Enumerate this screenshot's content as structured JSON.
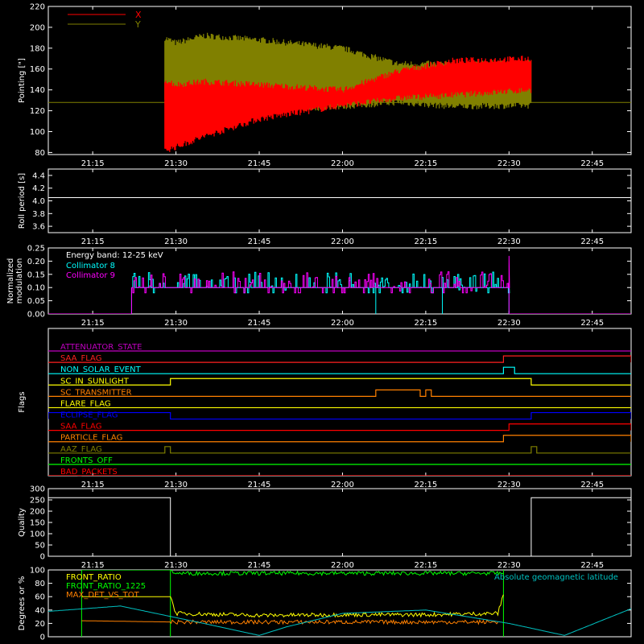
{
  "x_tick_labels": [
    "21:15",
    "21:30",
    "21:45",
    "22:00",
    "22:15",
    "22:30",
    "22:45"
  ],
  "chart_data": [
    {
      "id": "pointing",
      "type": "line",
      "ylabel": "Pointing [\"]",
      "xlabel": "",
      "xlim": [
        "21:07",
        "22:52"
      ],
      "ylim": [
        78,
        220
      ],
      "yticks": [
        80,
        100,
        120,
        140,
        160,
        180,
        200,
        220
      ],
      "x": [
        "21:28",
        "21:30",
        "21:35",
        "21:45",
        "22:00",
        "22:10",
        "22:20",
        "22:34"
      ],
      "series": [
        {
          "name": "X",
          "color": "#ff0000",
          "upper": [
            150,
            145,
            148,
            145,
            140,
            158,
            168,
            170
          ],
          "lower": [
            82,
            85,
            95,
            112,
            125,
            132,
            135,
            140
          ]
        },
        {
          "name": "Y",
          "color": "#808000",
          "upper": [
            190,
            185,
            192,
            188,
            180,
            165,
            165,
            166
          ],
          "lower": [
            128,
            118,
            116,
            120,
            124,
            128,
            124,
            125
          ]
        }
      ],
      "hline": 128,
      "legend_position": "top-left"
    },
    {
      "id": "roll_period",
      "type": "line",
      "ylabel": "Roll period [s]",
      "xlabel": "",
      "xlim": [
        "21:07",
        "22:52"
      ],
      "ylim": [
        3.5,
        4.5
      ],
      "yticks": [
        3.6,
        3.8,
        4.0,
        4.2,
        4.4
      ],
      "x": [
        "21:07",
        "22:52"
      ],
      "values": [
        4.05,
        4.05
      ]
    },
    {
      "id": "modulation",
      "type": "line",
      "ylabel": "Normalized modulation",
      "xlabel": "",
      "xlim": [
        "21:07",
        "22:52"
      ],
      "ylim": [
        0,
        0.25
      ],
      "yticks": [
        0.0,
        0.05,
        0.1,
        0.15,
        0.2,
        0.25
      ],
      "annotation": "Energy band: 12-25 keV",
      "series": [
        {
          "name": "Collimator 8",
          "color": "#00ffff",
          "baseline": 0.1,
          "start": "21:22",
          "end": "22:30"
        },
        {
          "name": "Collimator 9",
          "color": "#ff00ff",
          "baseline": 0.1,
          "start": "21:22",
          "end": "22:30"
        }
      ]
    },
    {
      "id": "flags",
      "type": "line",
      "ylabel": "Flags",
      "xlabel": "",
      "xlim": [
        "21:07",
        "22:52"
      ],
      "series": [
        {
          "name": "ATTENUATOR_STATE",
          "color": "#c000c0",
          "high": []
        },
        {
          "name": "SAA_FLAG",
          "color": "#ff2020",
          "high": [
            [
              "22:29",
              "22:52"
            ]
          ]
        },
        {
          "name": "NON_SOLAR_EVENT",
          "color": "#00ffff",
          "high": [
            [
              "22:29",
              "22:31"
            ]
          ]
        },
        {
          "name": "SC_IN_SUNLIGHT",
          "color": "#ffff00",
          "high": [
            [
              "21:29",
              "22:34"
            ]
          ]
        },
        {
          "name": "SC_TRANSMITTER",
          "color": "#ff8000",
          "high": [
            [
              "22:06",
              "22:14"
            ],
            [
              "22:15",
              "22:16"
            ]
          ]
        },
        {
          "name": "FLARE_FLAG",
          "color": "#ffff00",
          "high": []
        },
        {
          "name": "ECLIPSE_FLAG",
          "color": "#0000ff",
          "high": [
            [
              "21:07",
              "21:29"
            ],
            [
              "22:34",
              "22:52"
            ]
          ]
        },
        {
          "name": "SAA_FLAG",
          "color": "#ff0000",
          "high": [
            [
              "22:30",
              "22:52"
            ]
          ]
        },
        {
          "name": "PARTICLE_FLAG",
          "color": "#ff8000",
          "high": [
            [
              "22:29",
              "22:52"
            ]
          ]
        },
        {
          "name": "AAZ_FLAG",
          "color": "#808000",
          "high": [
            [
              "21:28",
              "21:29"
            ],
            [
              "22:34",
              "22:35"
            ]
          ]
        },
        {
          "name": "FRONTS_OFF",
          "color": "#00ff00",
          "high": []
        },
        {
          "name": "BAD_PACKETS",
          "color": "#ff0000",
          "high": []
        }
      ]
    },
    {
      "id": "quality",
      "type": "line",
      "ylabel": "Quality",
      "xlabel": "",
      "xlim": [
        "21:07",
        "22:52"
      ],
      "ylim": [
        0,
        300
      ],
      "yticks": [
        0,
        50,
        100,
        150,
        200,
        250,
        300
      ],
      "x": [
        "21:07",
        "21:29",
        "21:29",
        "22:34",
        "22:34",
        "22:52"
      ],
      "values": [
        260,
        260,
        0,
        0,
        260,
        260
      ]
    },
    {
      "id": "front_ratio",
      "type": "line",
      "ylabel": "Degrees or %",
      "xlabel": "",
      "xlim": [
        "21:07",
        "22:52"
      ],
      "ylim": [
        0,
        100
      ],
      "yticks": [
        0,
        20,
        40,
        60,
        80,
        100
      ],
      "annotation": "Absolute geomagnetic latitude",
      "series": [
        {
          "name": "FRONT_RATIO",
          "color": "#ffff00",
          "x": [
            "21:13",
            "21:29",
            "21:30",
            "21:45",
            "22:00",
            "22:15",
            "22:28",
            "22:29"
          ],
          "values": [
            60,
            60,
            35,
            32,
            33,
            33,
            35,
            63
          ]
        },
        {
          "name": "FRONT_RATIO_1225",
          "color": "#00ff00",
          "x": [
            "21:13",
            "21:29",
            "21:30",
            "22:00",
            "22:29"
          ],
          "values": [
            100,
            100,
            95,
            95,
            95
          ]
        },
        {
          "name": "MAX_DET_VS_TOT",
          "color": "#ff8000",
          "x": [
            "21:13",
            "21:30",
            "22:00",
            "22:28"
          ],
          "values": [
            24,
            22,
            22,
            22
          ]
        },
        {
          "name": "Absolute geomagnetic latitude",
          "color": "#00c0c0",
          "x": [
            "21:07",
            "21:20",
            "21:35",
            "21:45",
            "21:50",
            "22:00",
            "22:15",
            "22:30",
            "22:40",
            "22:52"
          ],
          "values": [
            38,
            46,
            20,
            2,
            15,
            35,
            40,
            20,
            2,
            42
          ]
        }
      ]
    }
  ]
}
